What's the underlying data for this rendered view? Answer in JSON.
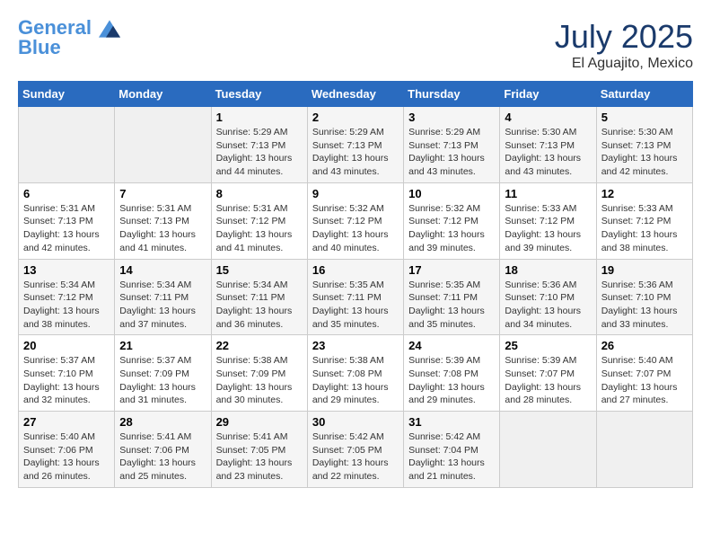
{
  "header": {
    "logo_line1": "General",
    "logo_line2": "Blue",
    "title": "July 2025",
    "subtitle": "El Aguajito, Mexico"
  },
  "days_of_week": [
    "Sunday",
    "Monday",
    "Tuesday",
    "Wednesday",
    "Thursday",
    "Friday",
    "Saturday"
  ],
  "weeks": [
    [
      {
        "day": "",
        "info": ""
      },
      {
        "day": "",
        "info": ""
      },
      {
        "day": "1",
        "sunrise": "5:29 AM",
        "sunset": "7:13 PM",
        "daylight": "13 hours and 44 minutes."
      },
      {
        "day": "2",
        "sunrise": "5:29 AM",
        "sunset": "7:13 PM",
        "daylight": "13 hours and 43 minutes."
      },
      {
        "day": "3",
        "sunrise": "5:29 AM",
        "sunset": "7:13 PM",
        "daylight": "13 hours and 43 minutes."
      },
      {
        "day": "4",
        "sunrise": "5:30 AM",
        "sunset": "7:13 PM",
        "daylight": "13 hours and 43 minutes."
      },
      {
        "day": "5",
        "sunrise": "5:30 AM",
        "sunset": "7:13 PM",
        "daylight": "13 hours and 42 minutes."
      }
    ],
    [
      {
        "day": "6",
        "sunrise": "5:31 AM",
        "sunset": "7:13 PM",
        "daylight": "13 hours and 42 minutes."
      },
      {
        "day": "7",
        "sunrise": "5:31 AM",
        "sunset": "7:13 PM",
        "daylight": "13 hours and 41 minutes."
      },
      {
        "day": "8",
        "sunrise": "5:31 AM",
        "sunset": "7:12 PM",
        "daylight": "13 hours and 41 minutes."
      },
      {
        "day": "9",
        "sunrise": "5:32 AM",
        "sunset": "7:12 PM",
        "daylight": "13 hours and 40 minutes."
      },
      {
        "day": "10",
        "sunrise": "5:32 AM",
        "sunset": "7:12 PM",
        "daylight": "13 hours and 39 minutes."
      },
      {
        "day": "11",
        "sunrise": "5:33 AM",
        "sunset": "7:12 PM",
        "daylight": "13 hours and 39 minutes."
      },
      {
        "day": "12",
        "sunrise": "5:33 AM",
        "sunset": "7:12 PM",
        "daylight": "13 hours and 38 minutes."
      }
    ],
    [
      {
        "day": "13",
        "sunrise": "5:34 AM",
        "sunset": "7:12 PM",
        "daylight": "13 hours and 38 minutes."
      },
      {
        "day": "14",
        "sunrise": "5:34 AM",
        "sunset": "7:11 PM",
        "daylight": "13 hours and 37 minutes."
      },
      {
        "day": "15",
        "sunrise": "5:34 AM",
        "sunset": "7:11 PM",
        "daylight": "13 hours and 36 minutes."
      },
      {
        "day": "16",
        "sunrise": "5:35 AM",
        "sunset": "7:11 PM",
        "daylight": "13 hours and 35 minutes."
      },
      {
        "day": "17",
        "sunrise": "5:35 AM",
        "sunset": "7:11 PM",
        "daylight": "13 hours and 35 minutes."
      },
      {
        "day": "18",
        "sunrise": "5:36 AM",
        "sunset": "7:10 PM",
        "daylight": "13 hours and 34 minutes."
      },
      {
        "day": "19",
        "sunrise": "5:36 AM",
        "sunset": "7:10 PM",
        "daylight": "13 hours and 33 minutes."
      }
    ],
    [
      {
        "day": "20",
        "sunrise": "5:37 AM",
        "sunset": "7:10 PM",
        "daylight": "13 hours and 32 minutes."
      },
      {
        "day": "21",
        "sunrise": "5:37 AM",
        "sunset": "7:09 PM",
        "daylight": "13 hours and 31 minutes."
      },
      {
        "day": "22",
        "sunrise": "5:38 AM",
        "sunset": "7:09 PM",
        "daylight": "13 hours and 30 minutes."
      },
      {
        "day": "23",
        "sunrise": "5:38 AM",
        "sunset": "7:08 PM",
        "daylight": "13 hours and 29 minutes."
      },
      {
        "day": "24",
        "sunrise": "5:39 AM",
        "sunset": "7:08 PM",
        "daylight": "13 hours and 29 minutes."
      },
      {
        "day": "25",
        "sunrise": "5:39 AM",
        "sunset": "7:07 PM",
        "daylight": "13 hours and 28 minutes."
      },
      {
        "day": "26",
        "sunrise": "5:40 AM",
        "sunset": "7:07 PM",
        "daylight": "13 hours and 27 minutes."
      }
    ],
    [
      {
        "day": "27",
        "sunrise": "5:40 AM",
        "sunset": "7:06 PM",
        "daylight": "13 hours and 26 minutes."
      },
      {
        "day": "28",
        "sunrise": "5:41 AM",
        "sunset": "7:06 PM",
        "daylight": "13 hours and 25 minutes."
      },
      {
        "day": "29",
        "sunrise": "5:41 AM",
        "sunset": "7:05 PM",
        "daylight": "13 hours and 23 minutes."
      },
      {
        "day": "30",
        "sunrise": "5:42 AM",
        "sunset": "7:05 PM",
        "daylight": "13 hours and 22 minutes."
      },
      {
        "day": "31",
        "sunrise": "5:42 AM",
        "sunset": "7:04 PM",
        "daylight": "13 hours and 21 minutes."
      },
      {
        "day": "",
        "info": ""
      },
      {
        "day": "",
        "info": ""
      }
    ]
  ]
}
